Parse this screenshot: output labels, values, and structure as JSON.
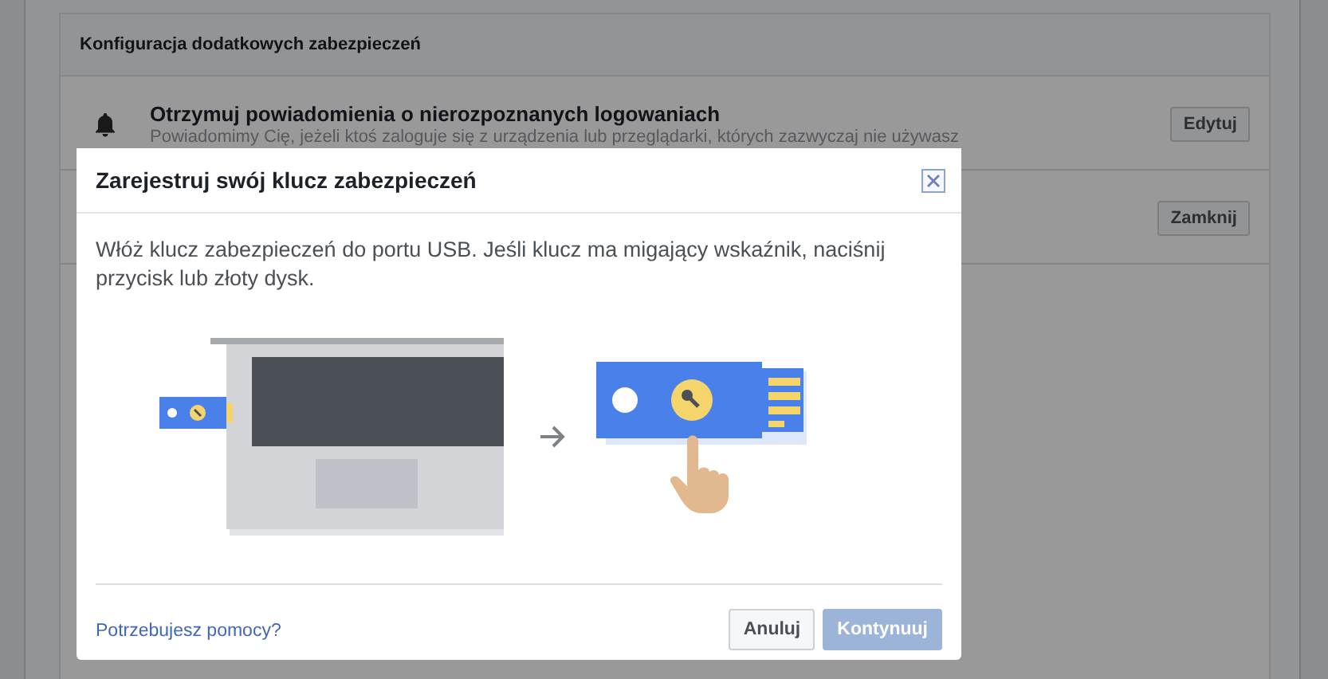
{
  "settings_panel": {
    "title": "Konfiguracja dodatkowych zabezpieczeń",
    "rows": [
      {
        "title": "Otrzymuj powiadomienia o nierozpoznanych logowaniach",
        "description": "Powiadomimy Cię, jeżeli ktoś zaloguje się z urządzenia lub przeglądarki, których zazwyczaj nie używasz",
        "button": "Edytuj",
        "kind": "alert"
      },
      {
        "button": "Zamknij",
        "kind": "plain"
      }
    ]
  },
  "dialog": {
    "title": "Zarejestruj swój klucz zabezpieczeń",
    "message": "Włóż klucz zabezpieczeń do portu USB. Jeśli klucz ma migający wskaźnik, naciśnij przycisk lub złoty dysk.",
    "help_link": "Potrzebujesz pomocy?",
    "buttons": [
      {
        "label": "Anuluj",
        "kind": "secondary",
        "disabled": false
      },
      {
        "label": "Kontynuuj",
        "kind": "primary",
        "disabled": true
      }
    ]
  }
}
